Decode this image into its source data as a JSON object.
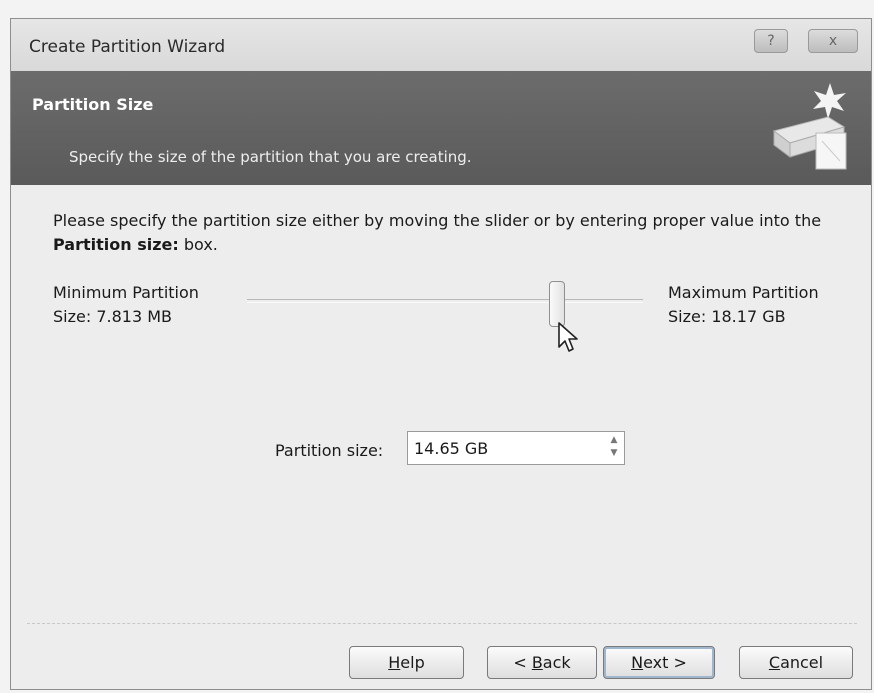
{
  "window": {
    "title": "Create Partition Wizard",
    "help_glyph": "?",
    "close_glyph": "x"
  },
  "banner": {
    "title": "Partition Size",
    "subtitle": "Specify the size of the partition that you are creating."
  },
  "body": {
    "intro_text": "Please specify the partition size either by moving the slider or by entering proper value into the ",
    "intro_bold": "Partition size:",
    "intro_tail": " box.",
    "min_line1": "Minimum Partition",
    "min_line2": "Size: 7.813 MB",
    "max_line1": "Maximum Partition",
    "max_line2": "Size: 18.17 GB",
    "slider_value_gb": 14.65,
    "partition_size_label": "Partition size:",
    "partition_size_value": "14.65 GB"
  },
  "buttons": {
    "help_pre": "",
    "help_key": "H",
    "help_post": "elp",
    "back_pre": "< ",
    "back_key": "B",
    "back_post": "ack",
    "next_pre": "",
    "next_key": "N",
    "next_post": "ext >",
    "cancel_pre": "",
    "cancel_key": "C",
    "cancel_post": "ancel"
  },
  "icons": {
    "wizard": "disk-partition-icon",
    "cursor": "mouse-pointer-icon",
    "spinner": "spin-up-down-icon"
  }
}
